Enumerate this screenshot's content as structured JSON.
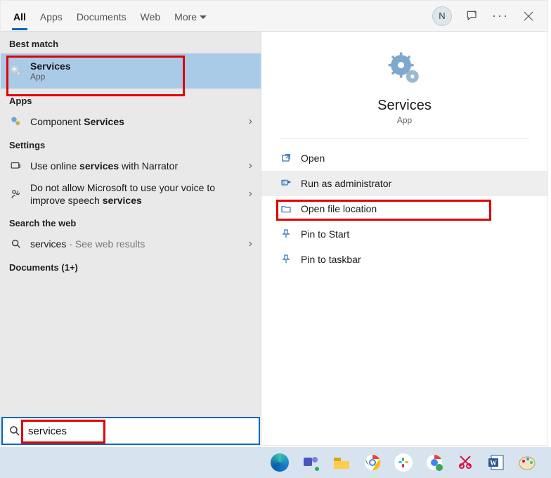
{
  "tabs": {
    "all": "All",
    "apps": "Apps",
    "documents": "Documents",
    "web": "Web",
    "more": "More"
  },
  "user_initial": "N",
  "sections": {
    "best_match": "Best match",
    "apps": "Apps",
    "settings": "Settings",
    "search_web": "Search the web",
    "documents": "Documents (1+)"
  },
  "best": {
    "title": "Services",
    "subtitle": "App"
  },
  "apps_list": [
    {
      "prefix": "Component ",
      "bold": "Services"
    }
  ],
  "settings_list": [
    {
      "pre": "Use online ",
      "bold": "services",
      "post": " with Narrator"
    },
    {
      "pre": "Do not allow Microsoft to use your voice to improve speech ",
      "bold": "services",
      "post": ""
    }
  ],
  "web": {
    "term": "services",
    "suffix": " - See web results"
  },
  "detail": {
    "title": "Services",
    "subtitle": "App"
  },
  "actions": {
    "open": "Open",
    "run_admin": "Run as administrator",
    "open_loc": "Open file location",
    "pin_start": "Pin to Start",
    "pin_taskbar": "Pin to taskbar"
  },
  "search_value": "services"
}
